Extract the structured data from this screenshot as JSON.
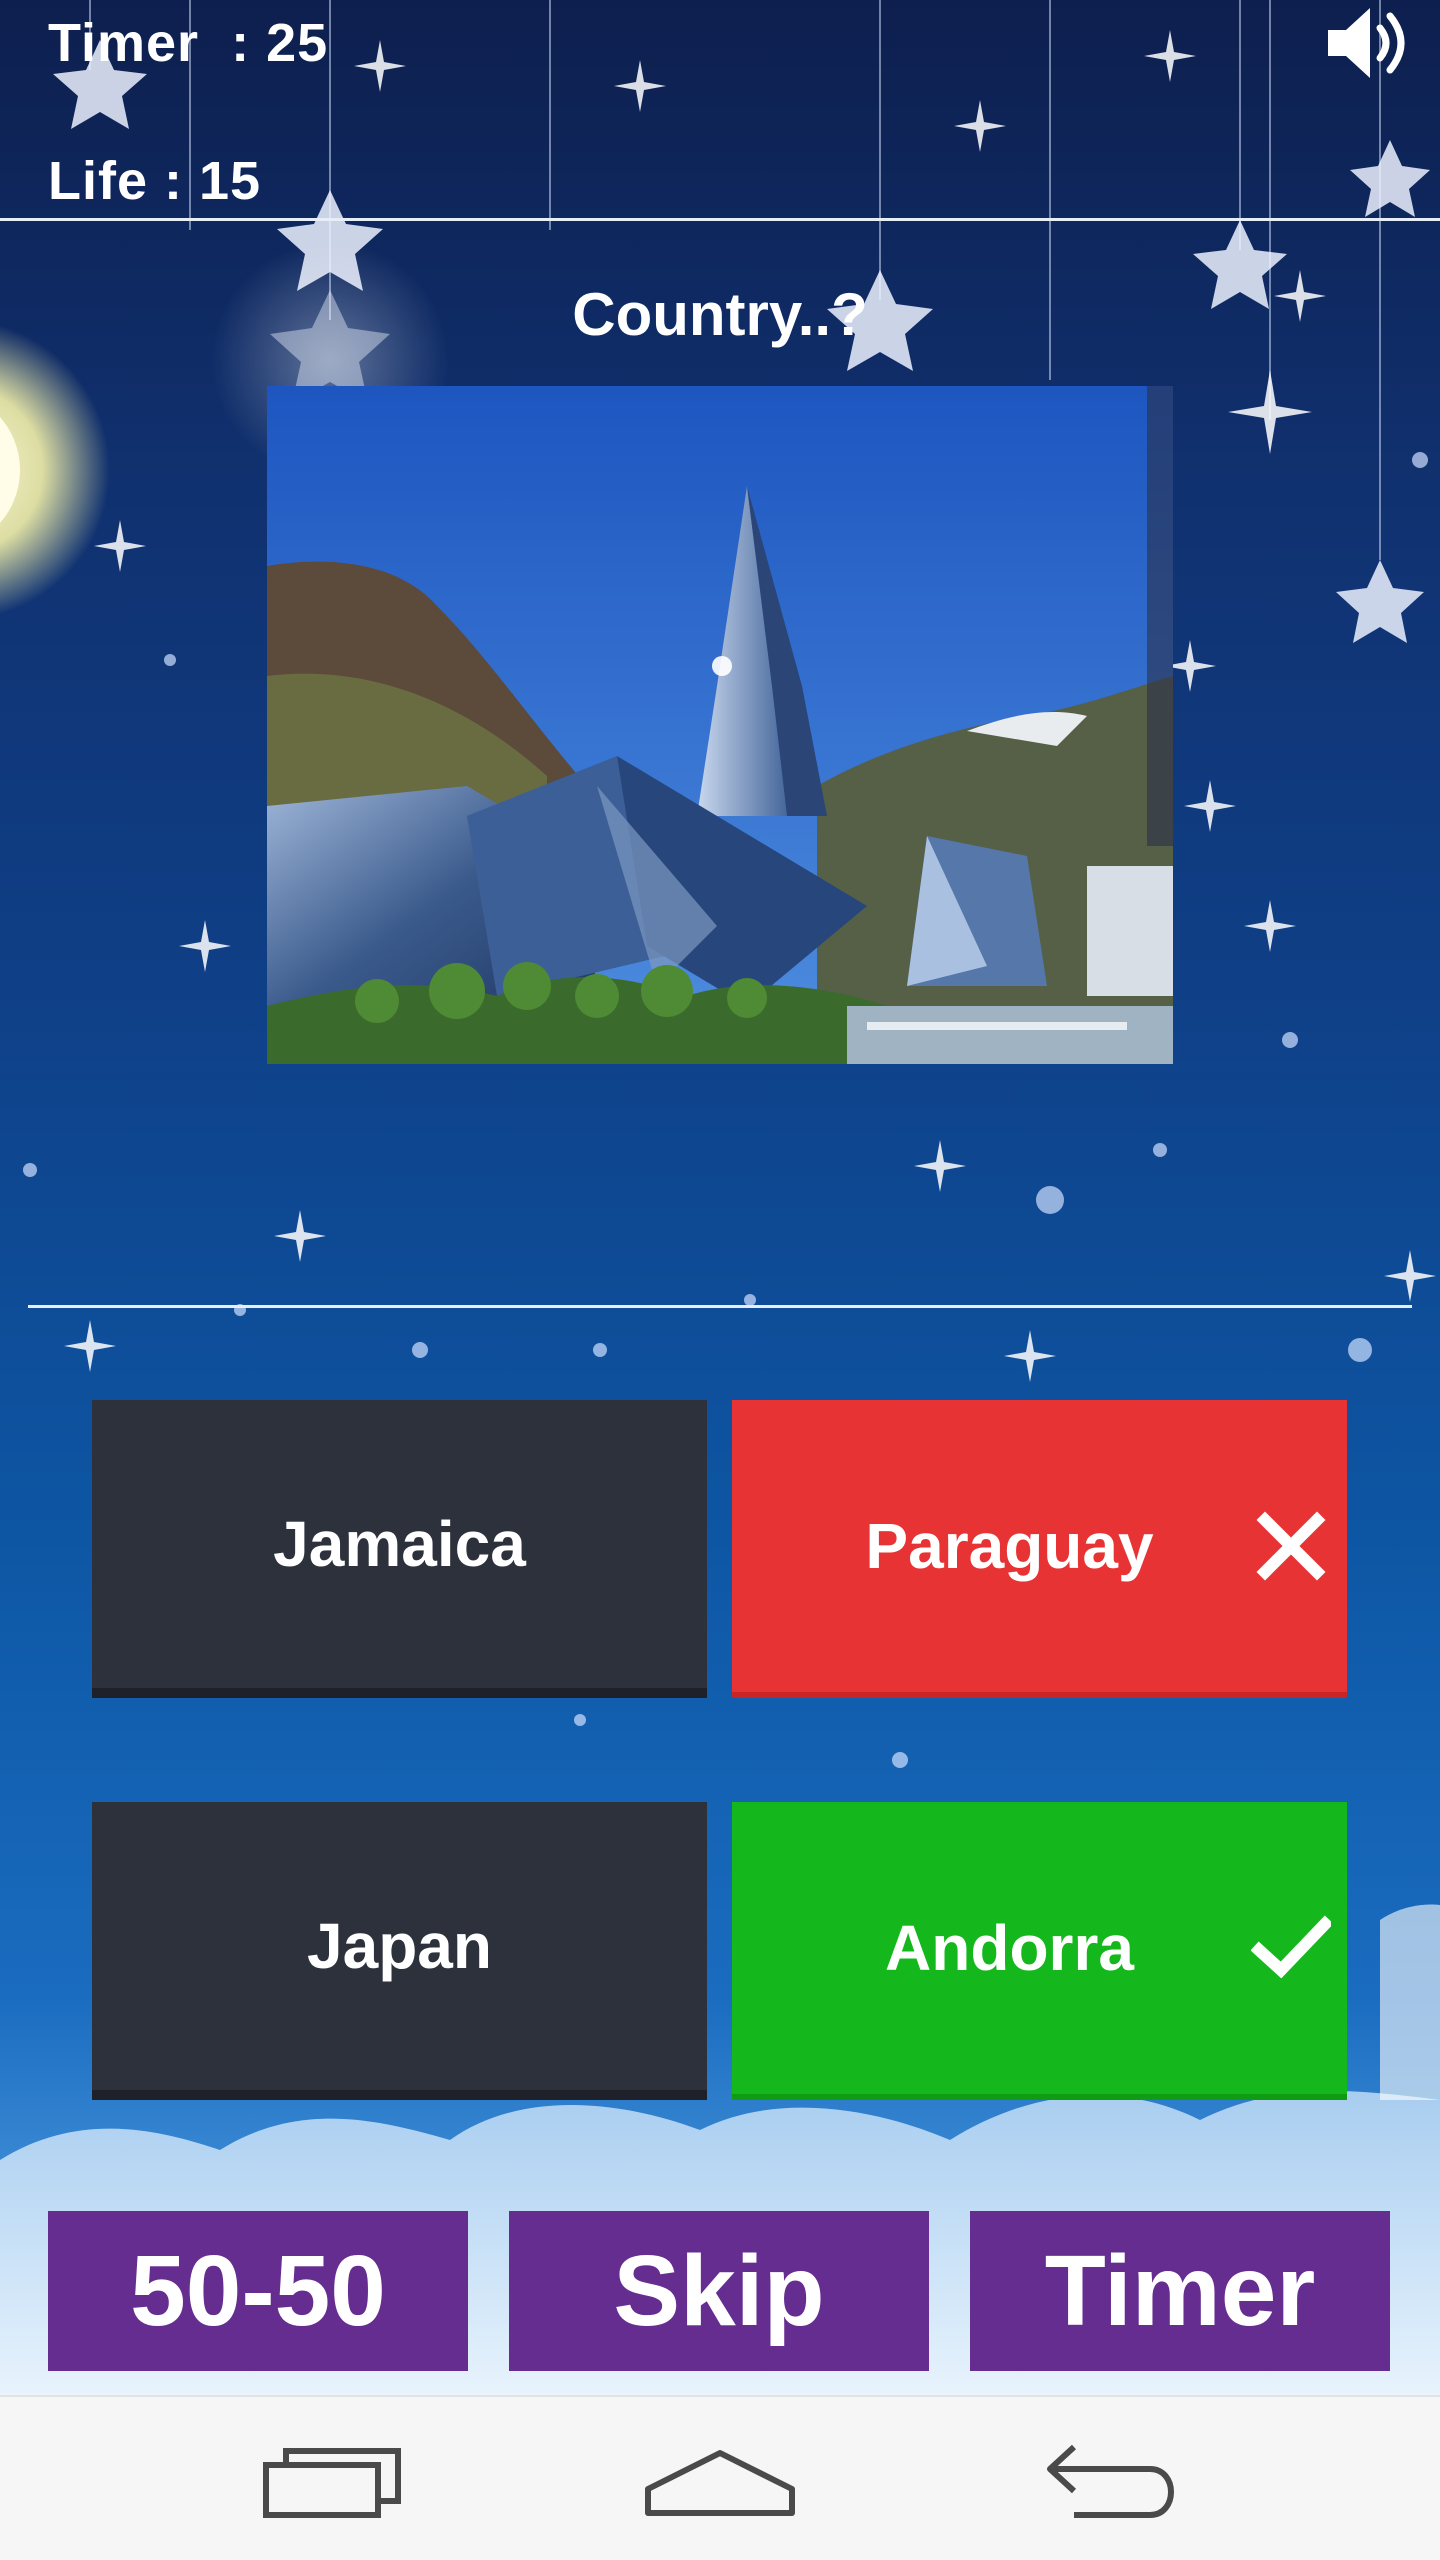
{
  "hud": {
    "timer_label": "Timer ",
    "timer_sep": " : ",
    "timer_value": "25",
    "life_label": "Life",
    "life_sep": " : ",
    "life_value": "15"
  },
  "question": {
    "text": "Country..?"
  },
  "answers": [
    {
      "label": "Jamaica",
      "state": "default"
    },
    {
      "label": "Paraguay",
      "state": "wrong"
    },
    {
      "label": "Japan",
      "state": "default"
    },
    {
      "label": "Andorra",
      "state": "correct"
    }
  ],
  "lifelines": {
    "fifty_fifty": "50-50",
    "skip": "Skip",
    "timer": "Timer"
  },
  "icons": {
    "sound": "speaker-icon",
    "wrong": "cross-icon",
    "right": "check-icon",
    "nav_recents": "recent-apps-icon",
    "nav_home": "home-icon",
    "nav_back": "back-icon"
  },
  "colors": {
    "answer_default": "#2d313c",
    "answer_wrong": "#e83334",
    "answer_correct": "#14b81c",
    "lifeline": "#662d91",
    "navbar": "#f6f6f6"
  }
}
